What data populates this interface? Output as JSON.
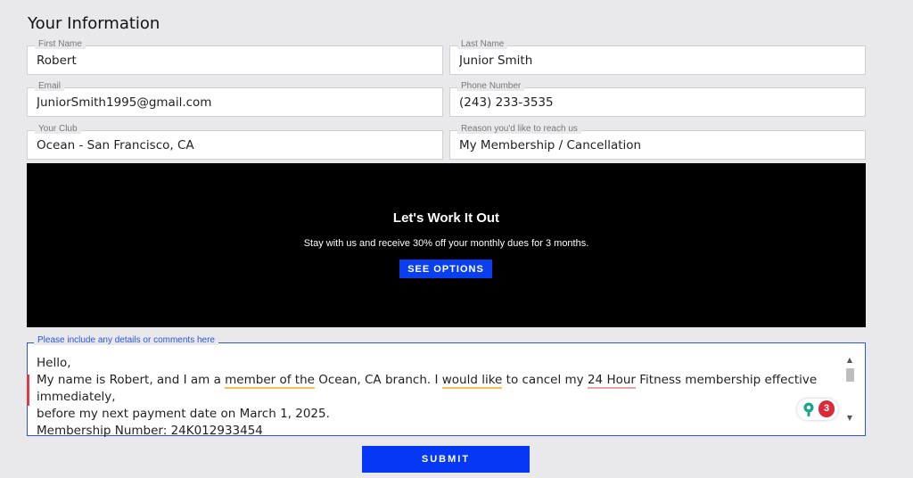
{
  "section_title": "Your Information",
  "fields": {
    "first_name": {
      "label": "First Name",
      "value": "Robert"
    },
    "last_name": {
      "label": "Last Name",
      "value": "Junior Smith"
    },
    "email": {
      "label": "Email",
      "value": "JuniorSmith1995@gmail.com"
    },
    "phone": {
      "label": "Phone Number",
      "value": "(243) 233-3535"
    },
    "club": {
      "label": "Your Club",
      "value": "Ocean - San Francisco, CA"
    },
    "reason": {
      "label": "Reason you'd like to reach us",
      "value": "My Membership / Cancellation"
    }
  },
  "promo": {
    "title": "Let's Work It Out",
    "subtitle": "Stay with us and receive 30% off your monthly dues for 3 months.",
    "button_label": "SEE OPTIONS"
  },
  "comments": {
    "label": "Please include any details or comments here",
    "line1": "Hello,",
    "line2_a": "My name is Robert, and I am a ",
    "line2_u1": "member of the",
    "line2_b": " Ocean, CA branch. I ",
    "line2_u2": "would like",
    "line2_c": " to cancel my ",
    "line2_u3": "24 Hour",
    "line2_d": " Fitness membership effective immediately,",
    "line3": "before my next payment date on March 1, 2025.",
    "line4": "Membership Number: 24K012933454"
  },
  "grammar_widget": {
    "count": "3",
    "icon": "lightbulb-icon"
  },
  "submit_label": "SUBMIT",
  "colors": {
    "background": "#e9e9ec",
    "promo_background": "#000000",
    "accent_blue": "#0637f5",
    "active_border": "#2a56d6",
    "error_red": "#d92a39"
  }
}
